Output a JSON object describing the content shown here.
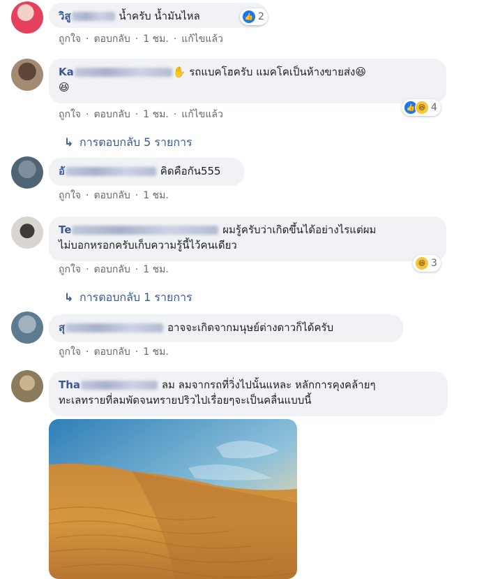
{
  "actions": {
    "like": "ถูกใจ",
    "reply": "ตอบกลับ",
    "separator": "·",
    "edited": "แก้ไขแล้ว"
  },
  "comments": [
    {
      "name_visible": "วิสู",
      "text": "น้ำครับ น้ำมันไหล",
      "time": "1 ชม.",
      "edited": true,
      "reaction_count": "2",
      "reactions": [
        "like"
      ]
    },
    {
      "name_visible": "Ka",
      "text": "รถแบคโฮครับ แมคโคเป็นห้างขายส่ง😆",
      "text2": "😆",
      "time": "1 ชม.",
      "edited": true,
      "reaction_count": "4",
      "reactions": [
        "like",
        "haha"
      ],
      "replies": "การตอบกลับ 5 รายการ"
    },
    {
      "name_visible": "อั",
      "text": "คิดคือกัน555",
      "time": "1 ชม.",
      "edited": false
    },
    {
      "name_visible": "Te",
      "text": "ผมรู้ครับว่าเกิดขึ้นได้อย่างไรแต่ผม",
      "text2": "ไม่บอกหรอกครับเก็บความรู้นี้ไว้คนเดียว",
      "time": "1 ชม.",
      "edited": false,
      "reaction_count": "3",
      "reactions": [
        "haha"
      ],
      "replies": "การตอบกลับ 1 รายการ"
    },
    {
      "name_visible": "สุ",
      "text": "อาจจะเกิดจากมนุษย์ต่างดาวก็ได้ครับ",
      "time": "1 ชม.",
      "edited": false
    },
    {
      "name_visible": "Tha",
      "text": "ลม ลมจากรถที่วิ่งไปนั้นแหละ หลักการคุงคล้ายๆ",
      "text2": "ทะเลทรายที่ลมพัดจนทรายปริวไปเรื่อยๆจะเป็นคลื่นแบบนี้"
    }
  ],
  "colors": {
    "name": "#385898",
    "bubble": "#f0f2f5",
    "meta": "#65676b",
    "like": "#1877f2",
    "haha": "#f7c63a"
  },
  "icons": {
    "reply_arrow": "reply-arrow-icon",
    "like": "like-icon",
    "haha": "haha-icon",
    "wave": "waving-hand-icon"
  }
}
